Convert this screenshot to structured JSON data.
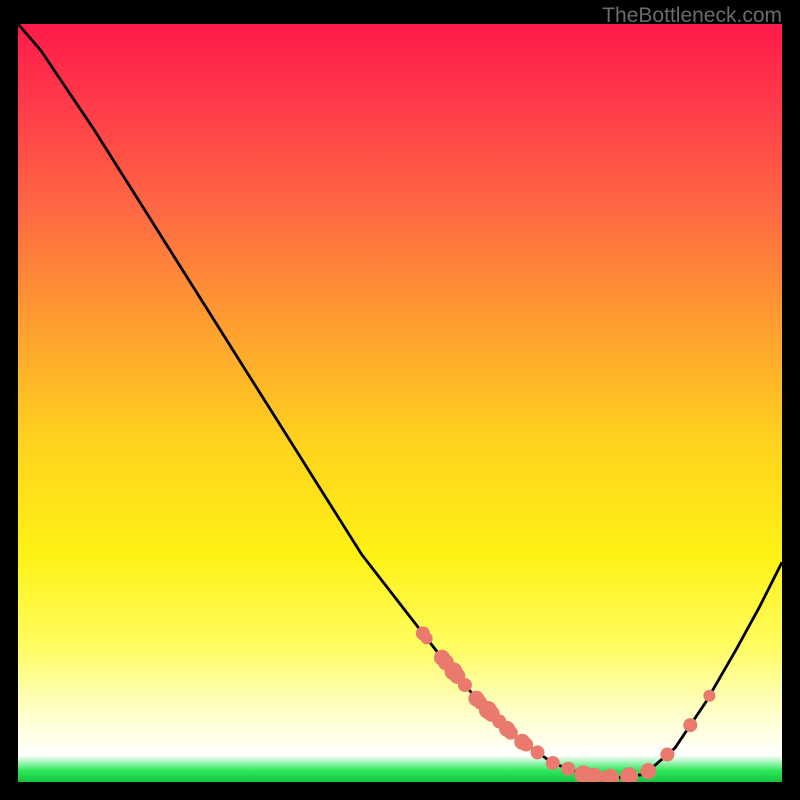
{
  "attribution": "TheBottleneck.com",
  "chart_data": {
    "type": "line",
    "title": "",
    "xlabel": "",
    "ylabel": "",
    "xlim": [
      0,
      1
    ],
    "ylim": [
      0,
      1
    ],
    "gradient_stops": [
      {
        "offset": 0.0,
        "color": "#ff1a4a"
      },
      {
        "offset": 0.12,
        "color": "#ff3f49"
      },
      {
        "offset": 0.25,
        "color": "#ff6a42"
      },
      {
        "offset": 0.4,
        "color": "#ffa030"
      },
      {
        "offset": 0.55,
        "color": "#ffd21e"
      },
      {
        "offset": 0.7,
        "color": "#fff215"
      },
      {
        "offset": 0.82,
        "color": "#fffc60"
      },
      {
        "offset": 0.9,
        "color": "#ffffc0"
      },
      {
        "offset": 0.94,
        "color": "#ffffe8"
      },
      {
        "offset": 0.965,
        "color": "#ffffff"
      },
      {
        "offset": 0.985,
        "color": "#2ee85b"
      },
      {
        "offset": 1.0,
        "color": "#15c43f"
      }
    ],
    "curve": [
      {
        "x": 0.0,
        "y": 1.0
      },
      {
        "x": 0.03,
        "y": 0.965
      },
      {
        "x": 0.06,
        "y": 0.92
      },
      {
        "x": 0.1,
        "y": 0.86
      },
      {
        "x": 0.15,
        "y": 0.78
      },
      {
        "x": 0.2,
        "y": 0.7
      },
      {
        "x": 0.25,
        "y": 0.62
      },
      {
        "x": 0.3,
        "y": 0.54
      },
      {
        "x": 0.35,
        "y": 0.46
      },
      {
        "x": 0.4,
        "y": 0.38
      },
      {
        "x": 0.45,
        "y": 0.3
      },
      {
        "x": 0.5,
        "y": 0.235
      },
      {
        "x": 0.55,
        "y": 0.17
      },
      {
        "x": 0.6,
        "y": 0.11
      },
      {
        "x": 0.65,
        "y": 0.06
      },
      {
        "x": 0.7,
        "y": 0.025
      },
      {
        "x": 0.74,
        "y": 0.01
      },
      {
        "x": 0.78,
        "y": 0.005
      },
      {
        "x": 0.82,
        "y": 0.01
      },
      {
        "x": 0.86,
        "y": 0.045
      },
      {
        "x": 0.9,
        "y": 0.105
      },
      {
        "x": 0.94,
        "y": 0.175
      },
      {
        "x": 0.97,
        "y": 0.23
      },
      {
        "x": 1.0,
        "y": 0.29
      }
    ],
    "dots": [
      {
        "x": 0.53,
        "y": 0.345,
        "r": 7
      },
      {
        "x": 0.535,
        "y": 0.335,
        "r": 6
      },
      {
        "x": 0.555,
        "y": 0.305,
        "r": 8
      },
      {
        "x": 0.56,
        "y": 0.295,
        "r": 8
      },
      {
        "x": 0.57,
        "y": 0.28,
        "r": 9
      },
      {
        "x": 0.575,
        "y": 0.27,
        "r": 8
      },
      {
        "x": 0.585,
        "y": 0.255,
        "r": 7
      },
      {
        "x": 0.6,
        "y": 0.232,
        "r": 8
      },
      {
        "x": 0.605,
        "y": 0.223,
        "r": 7
      },
      {
        "x": 0.615,
        "y": 0.21,
        "r": 9
      },
      {
        "x": 0.62,
        "y": 0.2,
        "r": 8
      },
      {
        "x": 0.63,
        "y": 0.185,
        "r": 7
      },
      {
        "x": 0.64,
        "y": 0.17,
        "r": 8
      },
      {
        "x": 0.645,
        "y": 0.16,
        "r": 7
      },
      {
        "x": 0.66,
        "y": 0.14,
        "r": 8
      },
      {
        "x": 0.665,
        "y": 0.13,
        "r": 7
      },
      {
        "x": 0.68,
        "y": 0.11,
        "r": 7
      },
      {
        "x": 0.7,
        "y": 0.085,
        "r": 7
      },
      {
        "x": 0.72,
        "y": 0.06,
        "r": 7
      },
      {
        "x": 0.74,
        "y": 0.04,
        "r": 9
      },
      {
        "x": 0.755,
        "y": 0.03,
        "r": 8
      },
      {
        "x": 0.775,
        "y": 0.023,
        "r": 9
      },
      {
        "x": 0.8,
        "y": 0.022,
        "r": 9
      },
      {
        "x": 0.825,
        "y": 0.03,
        "r": 8
      },
      {
        "x": 0.85,
        "y": 0.05,
        "r": 7
      },
      {
        "x": 0.88,
        "y": 0.095,
        "r": 7
      },
      {
        "x": 0.905,
        "y": 0.14,
        "r": 6
      }
    ]
  }
}
